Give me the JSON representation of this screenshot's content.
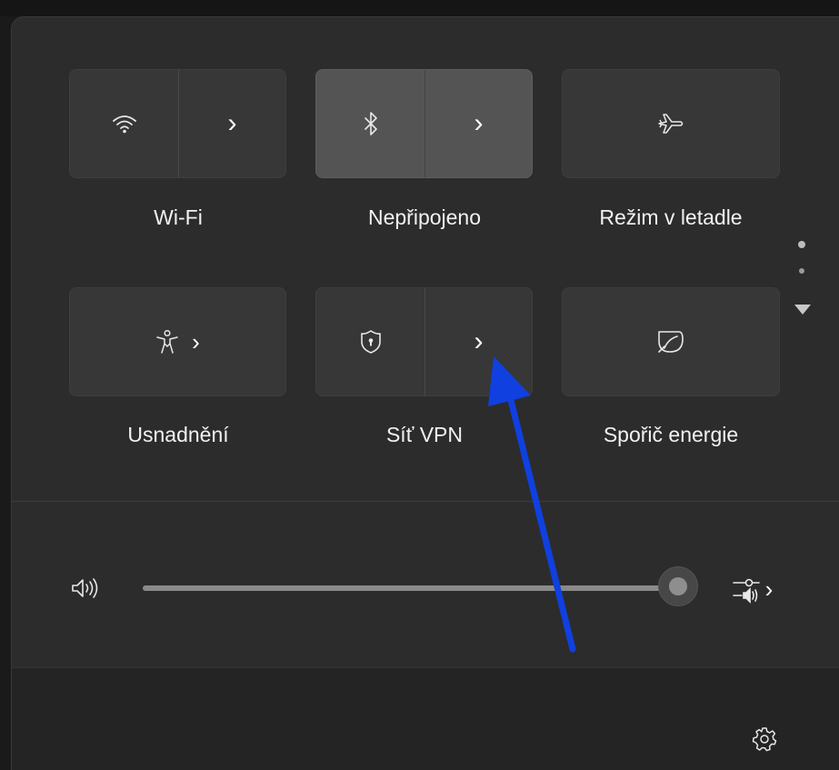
{
  "tiles": {
    "wifi": {
      "label": "Wi-Fi",
      "icon": "wifi-icon",
      "expand_icon": "chevron-right-icon",
      "active": false
    },
    "bluetooth": {
      "label": "Nepřipojeno",
      "icon": "bluetooth-icon",
      "expand_icon": "chevron-right-icon",
      "active": true
    },
    "airplane": {
      "label": "Režim v letadle",
      "icon": "airplane-icon",
      "active": false
    },
    "accessibility": {
      "label": "Usnadnění",
      "icon": "accessibility-icon",
      "expand_icon": "chevron-right-icon",
      "active": false
    },
    "vpn": {
      "label": "Síť VPN",
      "icon": "shield-icon",
      "expand_icon": "chevron-right-icon",
      "active": false
    },
    "battery_saver": {
      "label": "Spořič energie",
      "icon": "leaf-icon",
      "active": false
    }
  },
  "glyphs": {
    "chevron": "›"
  },
  "page_indicator": {
    "pages": 2,
    "current": 1
  },
  "volume": {
    "icon": "speaker-icon",
    "level": 0.97,
    "output_icon": "sound-output-icon"
  },
  "footer": {
    "settings_icon": "gear-icon"
  },
  "annotation": {
    "type": "arrow",
    "color": "#1040e0",
    "points_to": "vpn-expand-button"
  },
  "colors": {
    "panel": "#2c2c2c",
    "tile": "#373737",
    "tile_active": "#545454",
    "text": "#f2f2f2",
    "arrow": "#1040e0"
  }
}
